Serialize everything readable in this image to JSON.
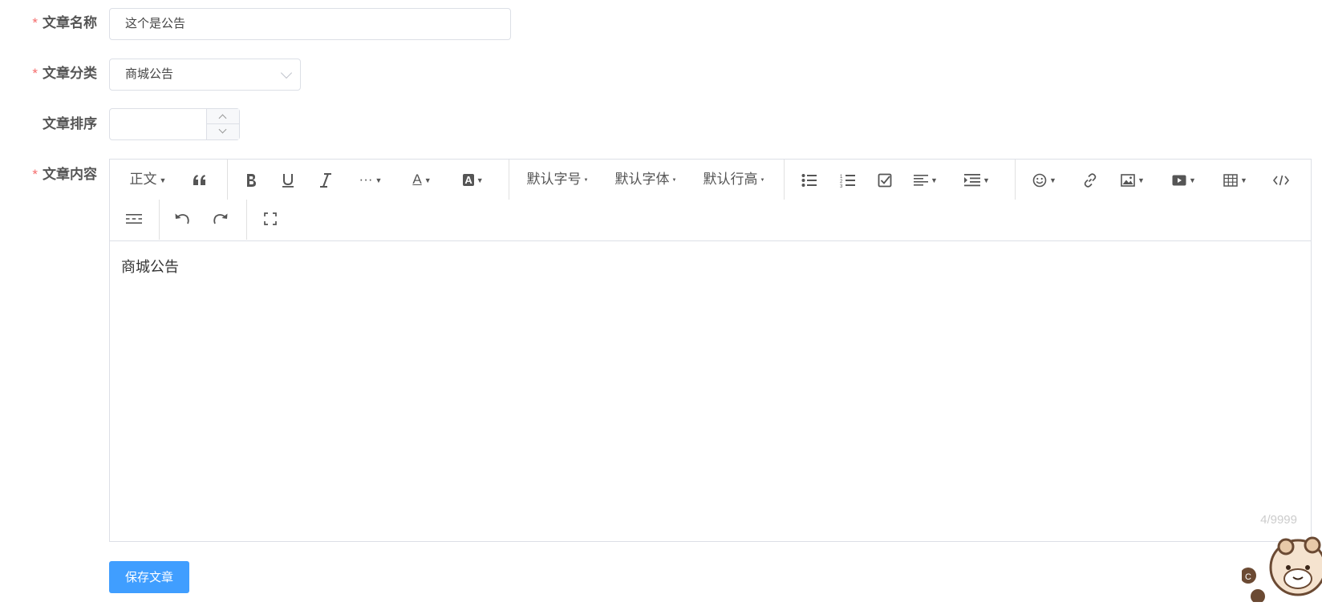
{
  "form": {
    "name": {
      "label": "文章名称",
      "required": true,
      "value": "这个是公告"
    },
    "category": {
      "label": "文章分类",
      "required": true,
      "value": "商城公告"
    },
    "sort": {
      "label": "文章排序",
      "required": false,
      "value": ""
    },
    "content": {
      "label": "文章内容",
      "required": true
    }
  },
  "editor": {
    "toolbar": {
      "paragraph": "正文",
      "font_size": "默认字号",
      "font_family": "默认字体",
      "line_height": "默认行高",
      "more": "···",
      "font_color": "A",
      "bg_color": "A"
    },
    "text": "商城公告",
    "counter": "4/9999"
  },
  "actions": {
    "save_label": "保存文章"
  },
  "colors": {
    "primary": "#409eff",
    "required_star": "#f56c6c",
    "border": "#dcdfe6"
  }
}
